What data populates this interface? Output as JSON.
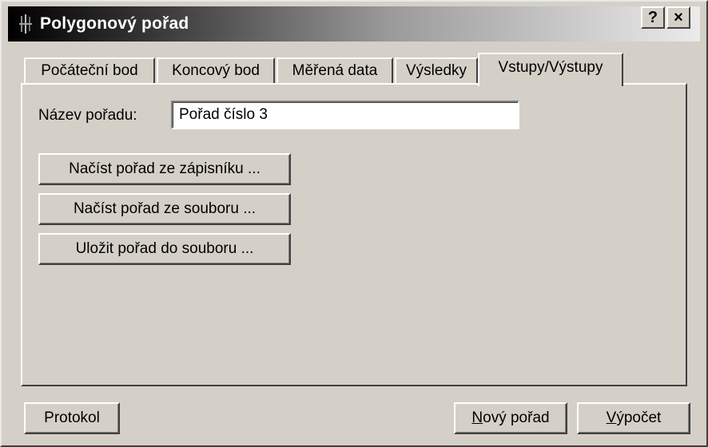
{
  "window": {
    "title": "Polygonový pořad",
    "help_label": "?",
    "close_label": "×"
  },
  "tabs": [
    {
      "label": "Počáteční bod"
    },
    {
      "label": "Koncový bod"
    },
    {
      "label": "Měřená data"
    },
    {
      "label": "Výsledky"
    },
    {
      "label": "Vstupy/Výstupy"
    }
  ],
  "active_tab": "Vstupy/Výstupy",
  "form": {
    "name_label": "Název pořadu:",
    "name_value": "Pořad číslo 3",
    "load_notebook_label": "Načíst pořad ze zápisníku ...",
    "load_file_label": "Načíst pořad ze souboru ...",
    "save_file_label": "Uložit pořad do souboru ..."
  },
  "footer": {
    "protocol_label": "Protokol",
    "new_route_mnemonic": "N",
    "new_route_rest": "ový pořad",
    "compute_mnemonic": "V",
    "compute_rest": "ýpočet"
  }
}
